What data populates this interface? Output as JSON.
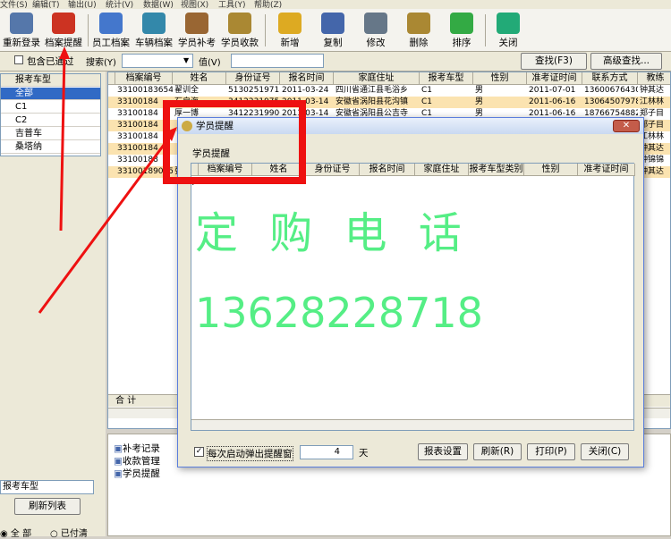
{
  "menu": [
    "文件(S)",
    "编辑(T)",
    "输出(U)",
    "统计(V)",
    "数据(W)",
    "视图(X)",
    "工具(Y)",
    "帮助(Z)"
  ],
  "toolbar": [
    {
      "label": "重新登录",
      "icon": "re-login-icon",
      "color": "#5577aa"
    },
    {
      "label": "档案提醒",
      "icon": "archive-reminder-icon",
      "color": "#cc3322"
    },
    {
      "label": "员工档案",
      "icon": "employee-archive-icon",
      "color": "#4477cc"
    },
    {
      "label": "车辆档案",
      "icon": "vehicle-archive-icon",
      "color": "#3388aa"
    },
    {
      "label": "学员补考",
      "icon": "student-retest-icon",
      "color": "#996633"
    },
    {
      "label": "学员收款",
      "icon": "student-payment-icon",
      "color": "#aa8833"
    },
    {
      "label": "新增",
      "icon": "add-icon",
      "color": "#ddaa22"
    },
    {
      "label": "复制",
      "icon": "copy-icon",
      "color": "#4466aa"
    },
    {
      "label": "修改",
      "icon": "edit-icon",
      "color": "#667788"
    },
    {
      "label": "删除",
      "icon": "delete-icon",
      "color": "#aa8833"
    },
    {
      "label": "排序",
      "icon": "sort-icon",
      "color": "#33aa44"
    },
    {
      "label": "关闭",
      "icon": "close-door-icon",
      "color": "#22aa77"
    }
  ],
  "search": {
    "include_label": "包含已通过",
    "search_label": "搜索(Y)",
    "value_label": "值(V)",
    "find_button": "查找(F3)",
    "advanced_button": "高级查找..."
  },
  "left": {
    "header": "报考车型",
    "items": [
      "全部",
      "C1",
      "C2",
      "吉普车",
      "桑塔纳"
    ],
    "filter_value": "报考车型",
    "refresh_button": "刷新列表",
    "radio_all": "全 部",
    "radio_paid": "已付清"
  },
  "grid": {
    "columns": [
      "档案编号",
      "姓名",
      "身份证号",
      "报名时间",
      "家庭住址",
      "报考车型",
      "性别",
      "准考证时间",
      "联系方式",
      "教练"
    ],
    "rows": [
      [
        "331001836540",
        "翟训全",
        "51302519711",
        "2011-03-24",
        "四川省通江县毛浴乡",
        "C1",
        "男",
        "2011-07-01",
        "13600676430",
        "钟其达"
      ],
      [
        "33100184",
        "石自海",
        "34122319750",
        "2011-03-14",
        "安徽省涡阳县花沟镇",
        "C1",
        "男",
        "2011-06-16",
        "13064507978",
        "江林林"
      ],
      [
        "33100184",
        "厚一博",
        "34122319900",
        "2011-03-14",
        "安徽省涡阳县公吉寺",
        "C1",
        "男",
        "2011-06-16",
        "18766754882",
        "郑子目"
      ],
      [
        "33100184",
        "",
        "",
        "",
        "",
        "",
        "",
        "",
        "",
        "郑子目"
      ],
      [
        "33100184",
        "",
        "",
        "",
        "",
        "",
        "",
        "",
        "",
        "江林林"
      ],
      [
        "33100184",
        "",
        "",
        "",
        "",
        "",
        "",
        "",
        "",
        "钟其达"
      ],
      [
        "33100188",
        "",
        "",
        "",
        "",
        "",
        "",
        "",
        "",
        "钟锦锦"
      ],
      [
        "33100189005",
        "张雪",
        "",
        "",
        "",
        "",
        "",
        "",
        "",
        "钟其达"
      ]
    ],
    "total_label": "合  计"
  },
  "side_tree": [
    "补考记录",
    "收款管理",
    "学员提醒"
  ],
  "dialog": {
    "title": "学员提醒",
    "close": "✕",
    "subtitle": "学员提醒",
    "columns": [
      "档案编号",
      "姓名",
      "身份证号",
      "报名时间",
      "家庭住址",
      "报考车型类别",
      "性别",
      "准考证时间"
    ],
    "big_line1": "定 购 电 话",
    "big_line2": "13628228718",
    "checkbox_label": "每次启动弹出提醒窗",
    "days_value": "4",
    "days_unit": "天",
    "btn_report": "报表设置",
    "btn_refresh": "刷新(R)",
    "btn_print": "打印(P)",
    "btn_close": "关闭(C)"
  },
  "colors": {
    "highlight": "#ee1111",
    "selection": "#316ac5",
    "big_text": "#55ee85",
    "row_alt": "#fbe3b0"
  }
}
